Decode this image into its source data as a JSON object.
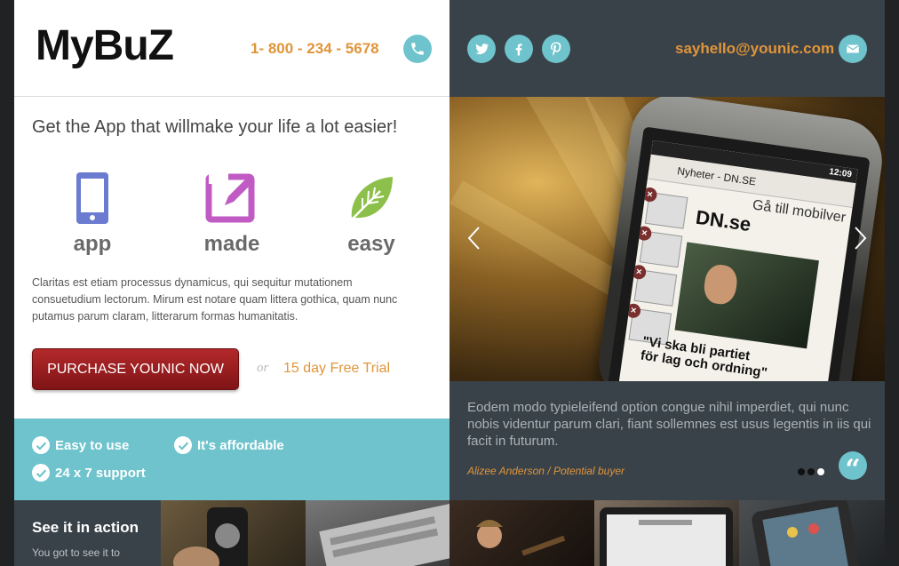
{
  "header": {
    "logo": "MyBuZ",
    "phone": "1- 800 - 234 - 5678",
    "email": "sayhello@younic.com",
    "social": [
      "twitter-icon",
      "facebook-icon",
      "pinterest-icon"
    ]
  },
  "hero": {
    "headline": "Get the App that willmake your life a lot easier!",
    "features": [
      {
        "label": "app",
        "icon": "smartphone-icon",
        "color": "#6a7bd0"
      },
      {
        "label": "made",
        "icon": "edit-icon",
        "color": "#c05bc4"
      },
      {
        "label": "easy",
        "icon": "leaf-icon",
        "color": "#8cc04a"
      }
    ],
    "paragraph": "Claritas est etiam processus dynamicus, qui sequitur mutationem consuetudium lectorum. Mirum est notare quam littera gothica, quam nunc putamus parum claram, litterarum formas humanitatis.",
    "purchase_button": "PURCHASE YOUNIC NOW",
    "or": "or",
    "trial_link": "15 day Free Trial"
  },
  "features_bar": {
    "items": [
      "Easy to use",
      "It's affordable",
      "24 x 7 support"
    ]
  },
  "slider": {
    "phone_time": "12:09",
    "phone_title": "Nyheter - DN.SE",
    "phone_subtitle": "Gå till mobilver",
    "phone_brand": "DN.se",
    "phone_headline_1": "\"Vi ska bli partiet",
    "phone_headline_2": "för lag och ordning\""
  },
  "testimonial": {
    "quote": "Eodem modo typieleifend option congue nihil imperdiet, qui nunc nobis videntur parum clari, fiant sollemnes est usus legentis in iis qui facit in futurum.",
    "author": "Alizee Anderson / Potential buyer",
    "quote_mark": "“"
  },
  "bottom": {
    "title": "See it in action",
    "text": "You got to see it to"
  },
  "colors": {
    "accent": "#6ec3cc",
    "orange": "#e0953a",
    "dark_panel": "#3a4249",
    "button_red": "#a32224"
  }
}
